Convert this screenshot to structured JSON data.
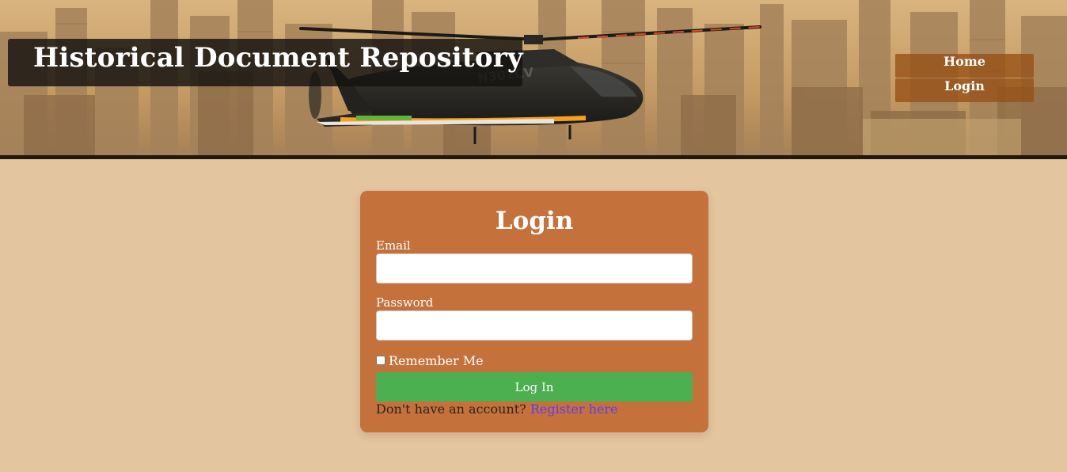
{
  "header": {
    "site_title": "Historical Document Repository",
    "helicopter_tail_number": "N301CV"
  },
  "nav": {
    "items": [
      {
        "label": "Home"
      },
      {
        "label": "Login"
      }
    ]
  },
  "login_form": {
    "title": "Login",
    "email_label": "Email",
    "email_value": "",
    "password_label": "Password",
    "password_value": "",
    "remember_label": "Remember Me",
    "remember_checked": false,
    "submit_label": "Log In",
    "register_prompt": "Don't have an account?",
    "register_link": "Register here"
  },
  "colors": {
    "page_background": "#e3c59f",
    "card_background": "#c4713c",
    "button_green": "#4caf50",
    "link_purple": "#5b3df0",
    "nav_item_bg": "#96501480"
  }
}
